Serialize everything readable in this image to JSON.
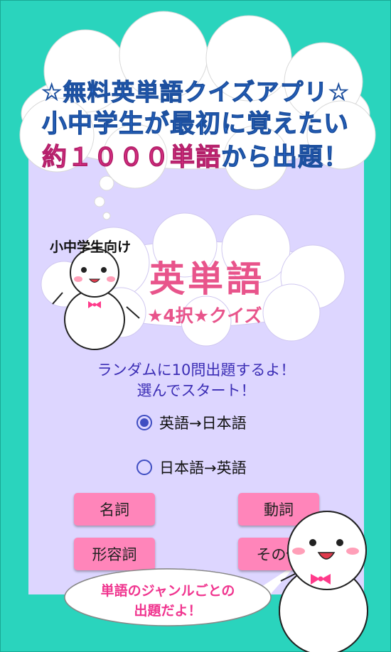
{
  "header": {
    "line1": "☆無料英単語クイズアプリ☆",
    "line2": "小中学生が最初に覚えたい",
    "line3_accent": "約１０００単語",
    "line3_rest": "から出題！"
  },
  "logo": {
    "tagline": "小中学生向け",
    "title": "英単語",
    "subtitle": "★4択★クイズ"
  },
  "intro": {
    "line1": "ランダムに10問出題するよ！",
    "line2": "選んでスタート！"
  },
  "options": [
    {
      "label": "英語→日本語",
      "selected": true
    },
    {
      "label": "日本語→英語",
      "selected": false
    }
  ],
  "buttons": {
    "noun": "名詞",
    "verb": "動詞",
    "adjective": "形容詞",
    "other": "その他"
  },
  "bubble": {
    "line1": "単語のジャンルごとの",
    "line2": "出題だよ！"
  },
  "colors": {
    "background": "#2ad4bd",
    "panel": "#ddd6ff",
    "accent_pink": "#f0358f",
    "accent_blue": "#2a6fd6",
    "button": "#ff85ba"
  }
}
